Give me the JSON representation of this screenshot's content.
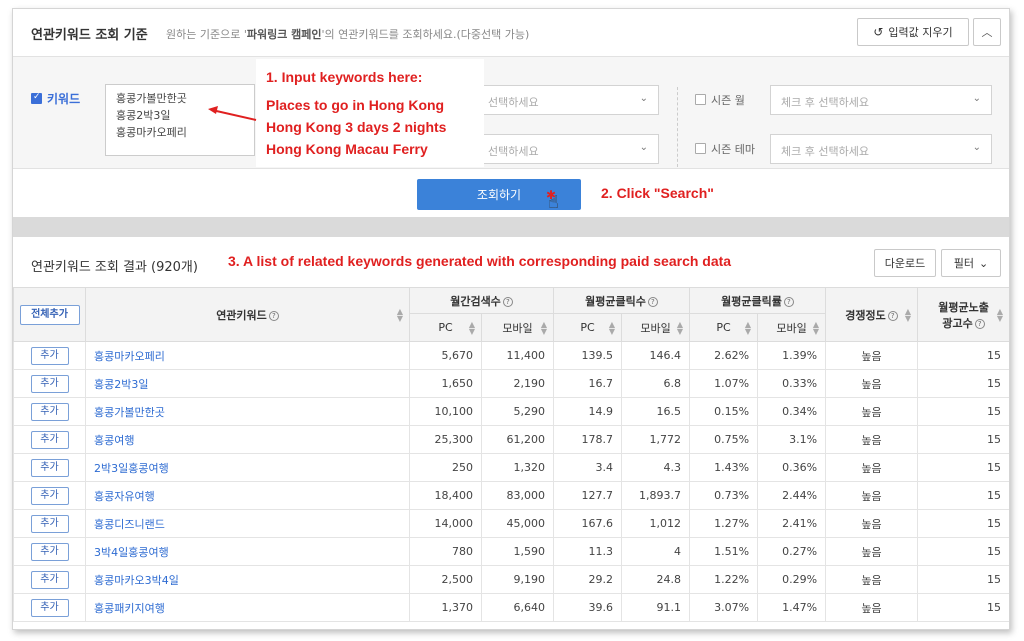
{
  "header": {
    "title": "연관키워드 조회 기준",
    "desc_prefix": "원하는 기준으로 '",
    "desc_bold": "파워링크 캠페인",
    "desc_suffix": "'의 연관키워드를 조회하세요.(다중선택 가능)",
    "clear_label": "입력값 지우기"
  },
  "criteria": {
    "keyword_label": "키워드",
    "keywords": [
      "홍콩가볼만한곳",
      "홍콩2박3일",
      "홍콩마카오페리"
    ],
    "select_placeholder_1": "선택하세요",
    "select_placeholder_2": "선택하세요",
    "season_month_label": "시즌 월",
    "season_theme_label": "시즌 테마",
    "check_placeholder_1": "체크 후 선택하세요",
    "check_placeholder_2": "체크 후 선택하세요"
  },
  "search": {
    "button_label": "조회하기"
  },
  "results": {
    "title": "연관키워드 조회 결과 (920개)",
    "download_label": "다운로드",
    "filter_label": "필터",
    "add_all_label": "전체추가",
    "add_label": "추가",
    "headers": {
      "keyword": "연관키워드",
      "monthly_search": "월간검색수",
      "monthly_clicks": "월평균클릭수",
      "monthly_ctr": "월평균클릭률",
      "competition": "경쟁정도",
      "ads_line1": "월평균노출",
      "ads_line2": "광고수",
      "pc": "PC",
      "mobile": "모바일"
    },
    "rows": [
      {
        "kw": "홍콩마카오페리",
        "s_pc": "5,670",
        "s_mo": "11,400",
        "c_pc": "139.5",
        "c_mo": "146.4",
        "r_pc": "2.62%",
        "r_mo": "1.39%",
        "comp": "높음",
        "ads": "15"
      },
      {
        "kw": "홍콩2박3일",
        "s_pc": "1,650",
        "s_mo": "2,190",
        "c_pc": "16.7",
        "c_mo": "6.8",
        "r_pc": "1.07%",
        "r_mo": "0.33%",
        "comp": "높음",
        "ads": "15"
      },
      {
        "kw": "홍콩가볼만한곳",
        "s_pc": "10,100",
        "s_mo": "5,290",
        "c_pc": "14.9",
        "c_mo": "16.5",
        "r_pc": "0.15%",
        "r_mo": "0.34%",
        "comp": "높음",
        "ads": "15"
      },
      {
        "kw": "홍콩여행",
        "s_pc": "25,300",
        "s_mo": "61,200",
        "c_pc": "178.7",
        "c_mo": "1,772",
        "r_pc": "0.75%",
        "r_mo": "3.1%",
        "comp": "높음",
        "ads": "15"
      },
      {
        "kw": "2박3일홍콩여행",
        "s_pc": "250",
        "s_mo": "1,320",
        "c_pc": "3.4",
        "c_mo": "4.3",
        "r_pc": "1.43%",
        "r_mo": "0.36%",
        "comp": "높음",
        "ads": "15"
      },
      {
        "kw": "홍콩자유여행",
        "s_pc": "18,400",
        "s_mo": "83,000",
        "c_pc": "127.7",
        "c_mo": "1,893.7",
        "r_pc": "0.73%",
        "r_mo": "2.44%",
        "comp": "높음",
        "ads": "15"
      },
      {
        "kw": "홍콩디즈니랜드",
        "s_pc": "14,000",
        "s_mo": "45,000",
        "c_pc": "167.6",
        "c_mo": "1,012",
        "r_pc": "1.27%",
        "r_mo": "2.41%",
        "comp": "높음",
        "ads": "15"
      },
      {
        "kw": "3박4일홍콩여행",
        "s_pc": "780",
        "s_mo": "1,590",
        "c_pc": "11.3",
        "c_mo": "4",
        "r_pc": "1.51%",
        "r_mo": "0.27%",
        "comp": "높음",
        "ads": "15"
      },
      {
        "kw": "홍콩마카오3박4일",
        "s_pc": "2,500",
        "s_mo": "9,190",
        "c_pc": "29.2",
        "c_mo": "24.8",
        "r_pc": "1.22%",
        "r_mo": "0.29%",
        "comp": "높음",
        "ads": "15"
      },
      {
        "kw": "홍콩패키지여행",
        "s_pc": "1,370",
        "s_mo": "6,640",
        "c_pc": "39.6",
        "c_mo": "91.1",
        "r_pc": "3.07%",
        "r_mo": "1.47%",
        "comp": "높음",
        "ads": "15"
      }
    ]
  },
  "annotations": {
    "step1_title": "1. Input keywords here:",
    "step1_lines": [
      "Places to go in Hong Kong",
      "Hong Kong 3 days 2 nights",
      "Hong Kong Macau Ferry"
    ],
    "step2": "2. Click \"Search\"",
    "step3": "3. A list of related keywords generated with corresponding paid search data"
  },
  "colors": {
    "accent": "#3b82d9",
    "annotation": "#e02020",
    "link": "#2d6bd2"
  }
}
